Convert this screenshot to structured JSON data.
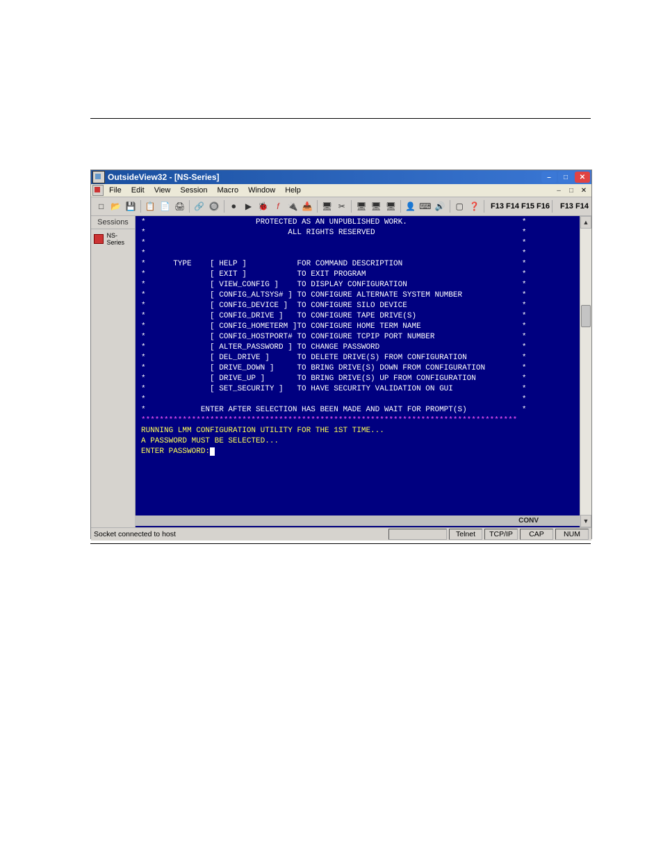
{
  "window": {
    "title": "OutsideView32 -  [NS-Series]"
  },
  "mdi": {
    "session_tab": "NS-Series"
  },
  "menu": {
    "items": [
      "File",
      "Edit",
      "View",
      "Session",
      "Macro",
      "Window",
      "Help"
    ]
  },
  "toolbar": {
    "fkeys1": "F13 F14 F15 F16",
    "fkeys2": "F13 F14"
  },
  "sidebar": {
    "header": "Sessions",
    "session": "NS-Series"
  },
  "terminal": {
    "lines": [
      {
        "cls": "",
        "pre": "*",
        "center": "PROTECTED AS AN UNPUBLISHED WORK.",
        "post": "*"
      },
      {
        "cls": "",
        "pre": "*",
        "center": "ALL RIGHTS RESERVED",
        "post": "*"
      },
      {
        "cls": "",
        "pre": "*",
        "center": "",
        "post": "*"
      },
      {
        "cls": "",
        "pre": "*",
        "center": "",
        "post": "*"
      },
      {
        "cls": "",
        "pre": "*",
        "col1": "TYPE",
        "col2": "[ HELP ]",
        "col3": "FOR COMMAND DESCRIPTION",
        "post": "*"
      },
      {
        "cls": "",
        "pre": "*",
        "col1": "",
        "col2": "[ EXIT ]",
        "col3": "TO EXIT PROGRAM",
        "post": "*"
      },
      {
        "cls": "",
        "pre": "*",
        "col1": "",
        "col2": "[ VIEW_CONFIG ]",
        "col3": "TO DISPLAY CONFIGURATION",
        "post": "*"
      },
      {
        "cls": "",
        "pre": "*",
        "col1": "",
        "col2": "[ CONFIG_ALTSYS# ]",
        "col3": "TO CONFIGURE ALTERNATE SYSTEM NUMBER",
        "post": "*"
      },
      {
        "cls": "",
        "pre": "*",
        "col1": "",
        "col2": "[ CONFIG_DEVICE ]",
        "col3": "TO CONFIGURE SILO DEVICE",
        "post": "*"
      },
      {
        "cls": "",
        "pre": "*",
        "col1": "",
        "col2": "[ CONFIG_DRIVE ]",
        "col3": "TO CONFIGURE TAPE DRIVE(S)",
        "post": "*"
      },
      {
        "cls": "",
        "pre": "*",
        "col1": "",
        "col2": "[ CONFIG_HOMETERM ]",
        "col3": "TO CONFIGURE HOME TERM NAME",
        "post": "*"
      },
      {
        "cls": "",
        "pre": "*",
        "col1": "",
        "col2": "[ CONFIG_HOSTPORT# ]",
        "col3": "TO CONFIGURE TCPIP PORT NUMBER",
        "post": "*"
      },
      {
        "cls": "",
        "pre": "*",
        "col1": "",
        "col2": "[ ALTER_PASSWORD ]",
        "col3": "TO CHANGE PASSWORD",
        "post": "*"
      },
      {
        "cls": "",
        "pre": "*",
        "col1": "",
        "col2": "[ DEL_DRIVE ]",
        "col3": "TO DELETE DRIVE(S) FROM CONFIGURATION",
        "post": "*"
      },
      {
        "cls": "",
        "pre": "*",
        "col1": "",
        "col2": "[ DRIVE_DOWN ]",
        "col3": "TO BRING DRIVE(S) DOWN FROM CONFIGURATION",
        "post": "*"
      },
      {
        "cls": "",
        "pre": "*",
        "col1": "",
        "col2": "[ DRIVE_UP ]",
        "col3": "TO BRING DRIVE(S) UP FROM CONFIGURATION",
        "post": "*"
      },
      {
        "cls": "",
        "pre": "*",
        "col1": "",
        "col2": "[ SET_SECURITY ]",
        "col3": "TO HAVE SECURITY VALIDATION ON GUI",
        "post": "*"
      },
      {
        "cls": "",
        "pre": "*",
        "center": "",
        "post": "*"
      },
      {
        "cls": "",
        "pre": "*",
        "center": "ENTER AFTER SELECTION HAS BEEN MADE AND WAIT FOR PROMPT(S)",
        "post": "*"
      },
      {
        "cls": "magenta",
        "raw": "**********************************************************************************"
      },
      {
        "cls": "yellow",
        "raw": "RUNNING LMM CONFIGURATION UTILITY FOR THE 1ST TIME..."
      },
      {
        "cls": "yellow",
        "raw": "A PASSWORD MUST BE SELECTED..."
      },
      {
        "cls": "",
        "raw": ""
      },
      {
        "cls": "yellow",
        "raw": "ENTER PASSWORD:",
        "cursor": true
      }
    ]
  },
  "convbar": {
    "text": "CONV"
  },
  "statusbar": {
    "left": "Socket connected to host",
    "telnet": "Telnet",
    "tcpip": "TCP/IP",
    "cap": "CAP",
    "num": "NUM"
  }
}
